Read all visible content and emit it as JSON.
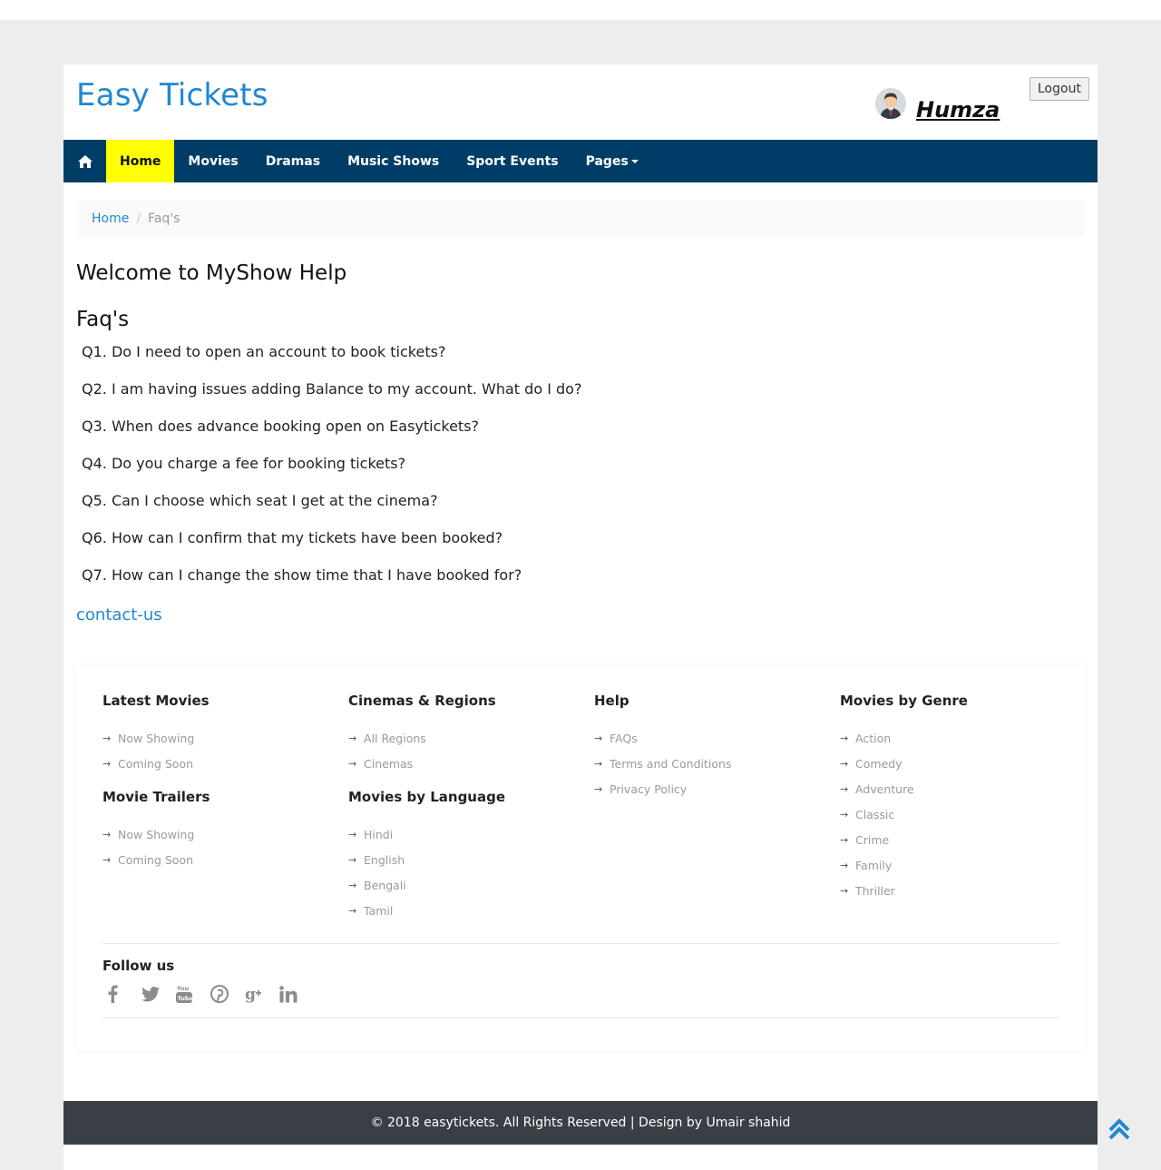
{
  "brand": {
    "title": "Easy Tickets"
  },
  "user": {
    "name": "Humza",
    "logout_label": "Logout"
  },
  "nav": {
    "items": [
      {
        "label": "Home"
      },
      {
        "label": "Movies"
      },
      {
        "label": "Dramas"
      },
      {
        "label": "Music Shows"
      },
      {
        "label": "Sport Events"
      },
      {
        "label": "Pages"
      }
    ],
    "active_color": "#ffff00",
    "bar_color": "#003d66"
  },
  "breadcrumb": {
    "home": "Home",
    "separator": "/",
    "current": "Faq's"
  },
  "main": {
    "heading": "Welcome to MyShow Help",
    "faq_heading": "Faq's",
    "questions": [
      "Q1. Do I need to open an account to book tickets?",
      "Q2. I am having issues adding Balance to my account. What do I do?",
      "Q3. When does advance booking open on Easytickets?",
      "Q4. Do you charge a fee for booking tickets?",
      "Q5. Can I choose which seat I get at the cinema?",
      "Q6. How can I confirm that my tickets have been booked?",
      "Q7. How can I change the show time that I have booked for?"
    ],
    "contact_link": "contact-us"
  },
  "footer": {
    "latest_movies": {
      "title": "Latest Movies",
      "items": [
        "Now Showing",
        "Coming Soon"
      ]
    },
    "movie_trailers": {
      "title": "Movie Trailers",
      "items": [
        "Now Showing",
        "Coming Soon"
      ]
    },
    "cinemas_regions": {
      "title": "Cinemas & Regions",
      "items": [
        "All Regions",
        "Cinemas"
      ]
    },
    "movies_by_language": {
      "title": "Movies by Language",
      "items": [
        "Hindi",
        "English",
        "Bengali",
        "Tamil"
      ]
    },
    "help": {
      "title": "Help",
      "items": [
        "FAQs",
        "Terms and Conditions",
        "Privacy Policy"
      ]
    },
    "movies_by_genre": {
      "title": "Movies by Genre",
      "items": [
        "Action",
        "Comedy",
        "Adventure",
        "Classic",
        "Crime",
        "Family",
        "Thriller"
      ]
    },
    "follow_us": "Follow us",
    "social_icons": [
      "facebook-icon",
      "twitter-icon",
      "youtube-icon",
      "pinterest-icon",
      "google-plus-icon",
      "linkedin-icon"
    ],
    "copyright": "© 2018 easytickets. All Rights Reserved | Design by Umair shahid"
  },
  "colors": {
    "brand_blue": "#1e88d2",
    "footer_bar": "#3a3f46"
  }
}
